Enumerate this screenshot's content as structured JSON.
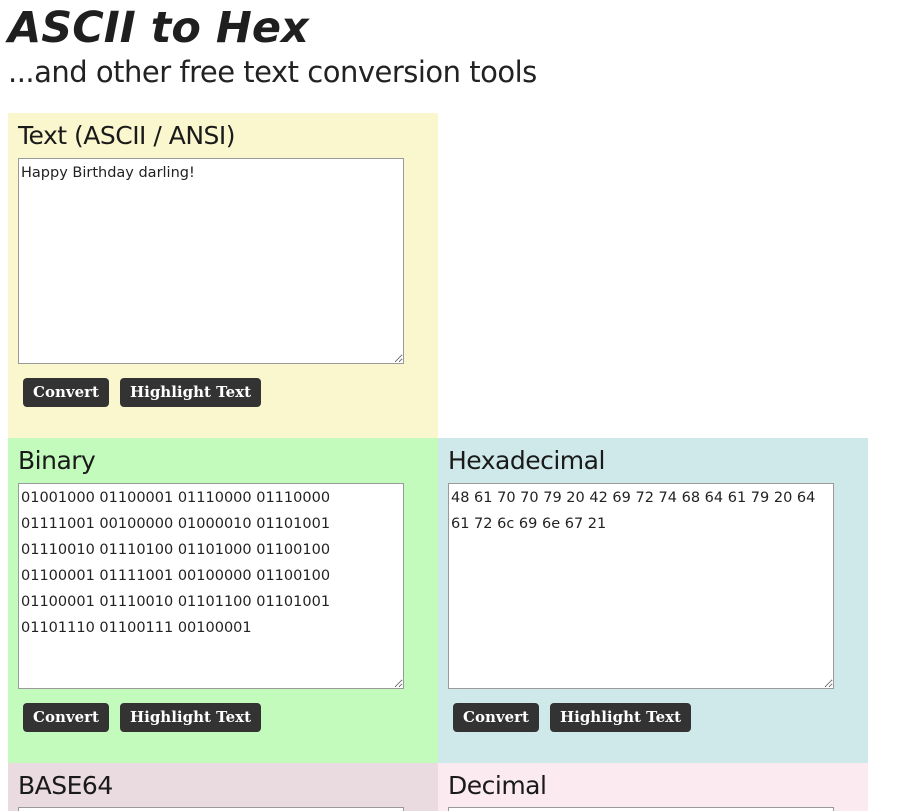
{
  "header": {
    "logo": "ASCII to Hex",
    "tagline": "...and other free text conversion tools"
  },
  "buttons": {
    "convert": "Convert",
    "highlight": "Highlight Text"
  },
  "panels": {
    "text": {
      "title": "Text (ASCII / ANSI)",
      "value": "Happy Birthday darling!",
      "color": "#faf7cf"
    },
    "binary": {
      "title": "Binary",
      "value": "01001000 01100001 01110000 01110000 01111001 00100000 01000010 01101001 01110010 01110100 01101000 01100100 01100001 01111001 00100000 01100100 01100001 01110010 01101100 01101001 01101110 01100111 00100001",
      "color": "#c3fbbd"
    },
    "hex": {
      "title": "Hexadecimal",
      "value": "48 61 70 70 79 20 42 69 72 74 68 64 61 79 20 64 61 72 6c 69 6e 67 21",
      "color": "#cfe9ea"
    },
    "base64": {
      "title": "BASE64",
      "color": "#eadbe0"
    },
    "decimal": {
      "title": "Decimal",
      "color": "#fbebf0"
    }
  }
}
